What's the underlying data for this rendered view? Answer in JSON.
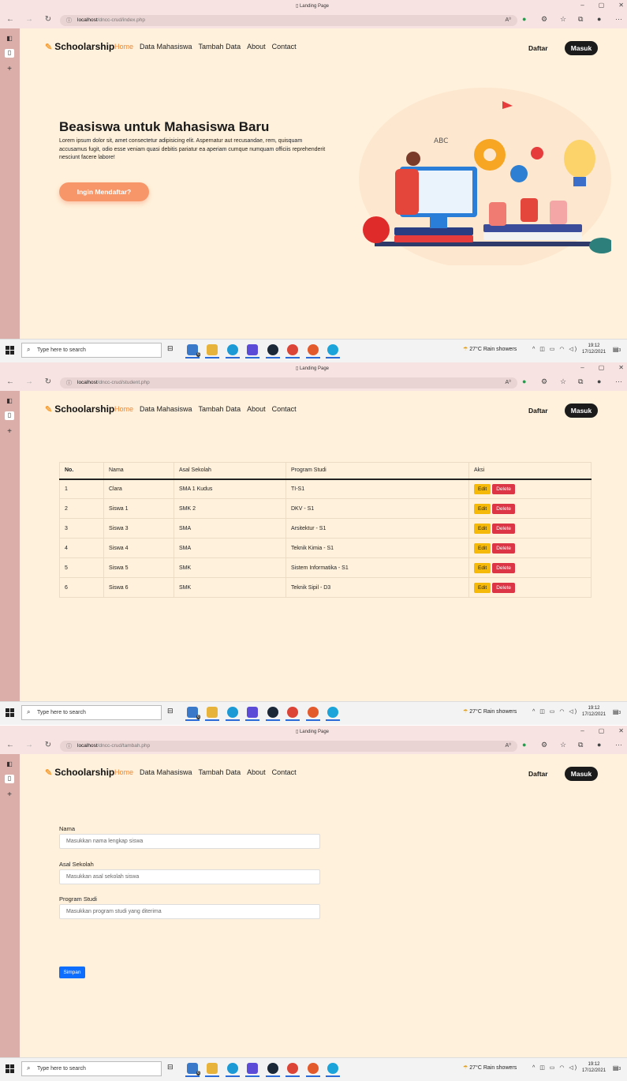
{
  "browser": {
    "tab_title": "Landing Page",
    "controls": {
      "minimize": "–",
      "maximize": "▢",
      "close": "✕"
    },
    "back": "←",
    "forward": "→",
    "refresh": "↻",
    "more": "···"
  },
  "site": {
    "brand": "Schoolarship",
    "nav": [
      "Home",
      "Data Mahasiswa",
      "Tambah Data",
      "About",
      "Contact"
    ],
    "daftar": "Daftar",
    "masuk": "Masuk",
    "accent": "#f0872f",
    "bg": "#fff1db"
  },
  "screens": [
    {
      "url_host": "localhost",
      "url_path": "/dncc-crud/index.php"
    },
    {
      "url_host": "localhost",
      "url_path": "/dncc-crud/student.php"
    },
    {
      "url_host": "localhost",
      "url_path": "/dncc-crud/tambah.php"
    }
  ],
  "hero": {
    "title": "Beasiswa untuk Mahasiswa Baru",
    "text": "Lorem ipsum dolor sit, amet consectetur adipisicing elit. Aspernatur aut recusandae, rem, quisquam accusamus fugit, odio esse veniam quasi debitis pariatur ea aperiam cumque numquam officiis reprehenderit nesciunt facere labore!",
    "cta": "Ingin Mendaftar?",
    "illu_abc": "ABC"
  },
  "table": {
    "headers": [
      "No.",
      "Nama",
      "Asal Sekolah",
      "Program Studi",
      "Aksi"
    ],
    "edit": "Edit",
    "delete": "Delete",
    "rows": [
      [
        "1",
        "Clara",
        "SMA 1 Kudus",
        "TI-S1"
      ],
      [
        "2",
        "Siswa 1",
        "SMK 2",
        "DKV - S1"
      ],
      [
        "3",
        "Siswa 3",
        "SMA",
        "Arsitektur - S1"
      ],
      [
        "4",
        "Siswa 4",
        "SMA",
        "Teknik Kimia - S1"
      ],
      [
        "5",
        "Siswa 5",
        "SMK",
        "Sistem Informatika - S1"
      ],
      [
        "6",
        "Siswa 6",
        "SMK",
        "Teknik Sipil - D3"
      ]
    ]
  },
  "form": {
    "nama_label": "Nama",
    "nama_ph": "Masukkan nama lengkap siswa",
    "sekolah_label": "Asal Sekolah",
    "sekolah_ph": "Masukkan asal sekolah siswa",
    "prodi_label": "Program Studi",
    "prodi_ph": "Masukkan program studi yang diterima",
    "submit": "Simpan"
  },
  "taskbar": {
    "search_placeholder": "Type here to search",
    "weather": "27°C  Rain showers",
    "time": "19:12",
    "date": "17/12/2021",
    "mail_badge": "6",
    "notif_count": "3"
  }
}
